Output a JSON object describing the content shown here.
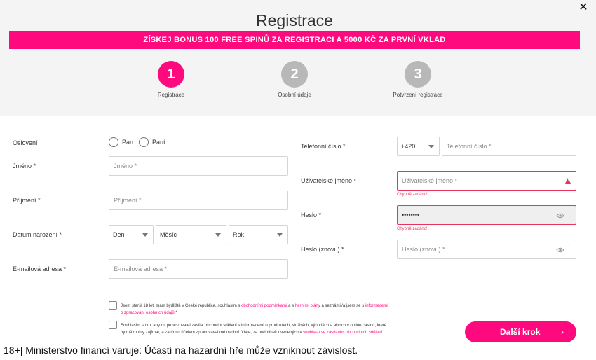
{
  "header": {
    "title": "Registrace",
    "close": "✕",
    "promo": "ZÍSKEJ BONUS 100 FREE SPINŮ ZA REGISTRACI A 5000 KČ ZA PRVNÍ VKLAD"
  },
  "steps": [
    {
      "number": "1",
      "label": "Registrace",
      "active": true
    },
    {
      "number": "2",
      "label": "Osobní údaje",
      "active": false
    },
    {
      "number": "3",
      "label": "Potvrzení registrace",
      "active": false
    }
  ],
  "form": {
    "salutation": {
      "label": "Oslovení",
      "options": [
        "Pan",
        "Paní"
      ]
    },
    "first_name": {
      "label": "Jméno *",
      "placeholder": "Jméno *"
    },
    "last_name": {
      "label": "Příjmení *",
      "placeholder": "Příjmení *"
    },
    "birth_date": {
      "label": "Datum narození *",
      "day": "Den",
      "month": "Měsíc",
      "year": "Rok"
    },
    "email": {
      "label": "E-mailová adresa *",
      "placeholder": "E-mailová adresa *"
    },
    "phone": {
      "label": "Telefonní číslo *",
      "prefix": "+420",
      "placeholder": "Telefonní číslo *"
    },
    "username": {
      "label": "Uživatelské jméno *",
      "placeholder": "Uživatelské jméno *",
      "error": "Chybně zadáno!"
    },
    "password": {
      "label": "Heslo *",
      "value": "••••••••",
      "error": "Chybně zadáno!"
    },
    "password_repeat": {
      "label": "Heslo (znovu) *",
      "placeholder": "Heslo (znovu) *"
    }
  },
  "consents": {
    "c1_a": "Jsem starší 18 let, mám bydliště v České republice, souhlasím s ",
    "c1_link1": "obchodními podmínkami",
    "c1_b": " a s ",
    "c1_link2": "herními plány",
    "c1_c": " a seznámil/a jsem se s ",
    "c1_link3": "informacemi o zpracování osobních údajů",
    "c1_d": ".*",
    "c2_a": "Souhlasím s tím, aby mi provozovatel zasílal obchodní sdělení s informacemi o produktech, službách, výhodách a akcích v online casinu, které by mě mohly zajímat, a za tímto účelem zpracovával mé osobní údaje, za podmínek uvedených v ",
    "c2_link": "souhlasu se zasíláním obchodních sdělení",
    "c2_b": "."
  },
  "actions": {
    "next": "Další krok",
    "next_arrow": "›"
  },
  "footer": {
    "warning": "18+| Ministerstvo financí varuje: Účastí na hazardní hře může vzniknout závislost."
  },
  "colors": {
    "accent": "#ff0a7e",
    "error": "#e8335e",
    "step_inactive": "#b8b8b8"
  }
}
